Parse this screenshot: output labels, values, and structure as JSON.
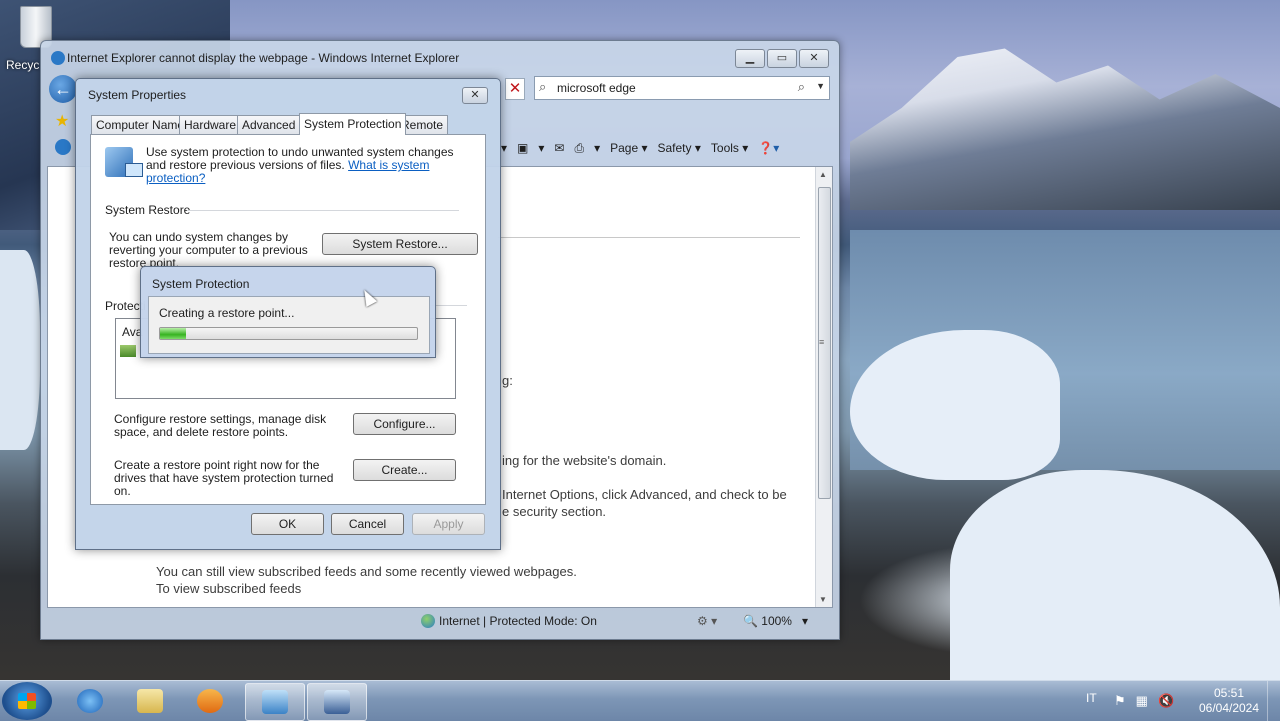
{
  "desktop": {
    "recycle_label": "Recyc"
  },
  "ie": {
    "title": "Internet Explorer cannot display the webpage - Windows Internet Explorer",
    "search_text": "microsoft edge",
    "cmd": {
      "page": "Page ▾",
      "safety": "Safety ▾",
      "tools": "Tools ▾"
    },
    "content": {
      "line1": "g:",
      "line2": "ing for the website's domain.",
      "line3": "Internet Options, click Advanced, and check to be",
      "line4": "e security section.",
      "line5": "You can still view subscribed feeds and some recently viewed webpages.",
      "line6": "To view subscribed feeds"
    },
    "status_zone": "Internet | Protected Mode: On",
    "zoom": "100%"
  },
  "sysprops": {
    "title": "System Properties",
    "tabs": [
      "Computer Name",
      "Hardware",
      "Advanced",
      "System Protection",
      "Remote"
    ],
    "intro": "Use system protection to undo unwanted system changes and restore previous versions of files.",
    "intro_link": "What is system protection?",
    "restore_group": "System Restore",
    "restore_text": "You can undo system changes by reverting your computer to a previous restore point.",
    "restore_button": "System Restore...",
    "protection_group": "Protecti",
    "list_header": "Ava",
    "configure_text": "Configure restore settings, manage disk space, and delete restore points.",
    "configure_button": "Configure...",
    "create_text": "Create a restore point right now for the drives that have system protection turned on.",
    "create_button": "Create...",
    "ok": "OK",
    "cancel": "Cancel",
    "apply": "Apply"
  },
  "progress_dialog": {
    "title": "System Protection",
    "message": "Creating a restore point...",
    "progress_fraction": 0.1
  },
  "taskbar": {
    "lang": "IT",
    "time": "05:51",
    "date": "06/04/2024"
  }
}
